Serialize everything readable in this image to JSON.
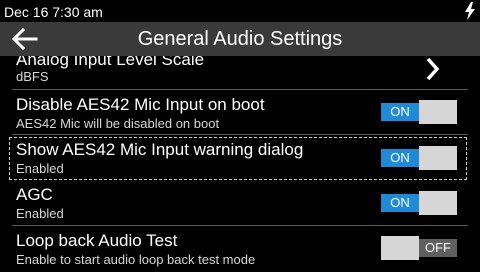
{
  "status": {
    "time": "Dec 16 7:30 am",
    "charging_icon": "lightning-bolt-icon"
  },
  "header": {
    "title": "General Audio Settings",
    "back_icon": "back-arrow-icon"
  },
  "settings": [
    {
      "title": "Analog Input Level Scale",
      "subtitle": "dBFS",
      "control": "chevron"
    },
    {
      "title": "Disable AES42 Mic Input on boot",
      "subtitle": "AES42 Mic will be disabled on boot",
      "control": "toggle",
      "state": "ON"
    },
    {
      "title": "Show AES42 Mic Input warning dialog",
      "subtitle": "Enabled",
      "control": "toggle",
      "state": "ON",
      "focused": true
    },
    {
      "title": "AGC",
      "subtitle": "Enabled",
      "control": "toggle",
      "state": "ON"
    },
    {
      "title": "Loop back Audio Test",
      "subtitle": "Enable to start audio loop back test mode",
      "control": "toggle",
      "state": "OFF"
    }
  ],
  "colors": {
    "toggle_on": "#1f8ad8",
    "toggle_knob": "#d6d6d6",
    "toggle_off": "#5f5f5f",
    "titlebar": "#3a3a3a"
  }
}
